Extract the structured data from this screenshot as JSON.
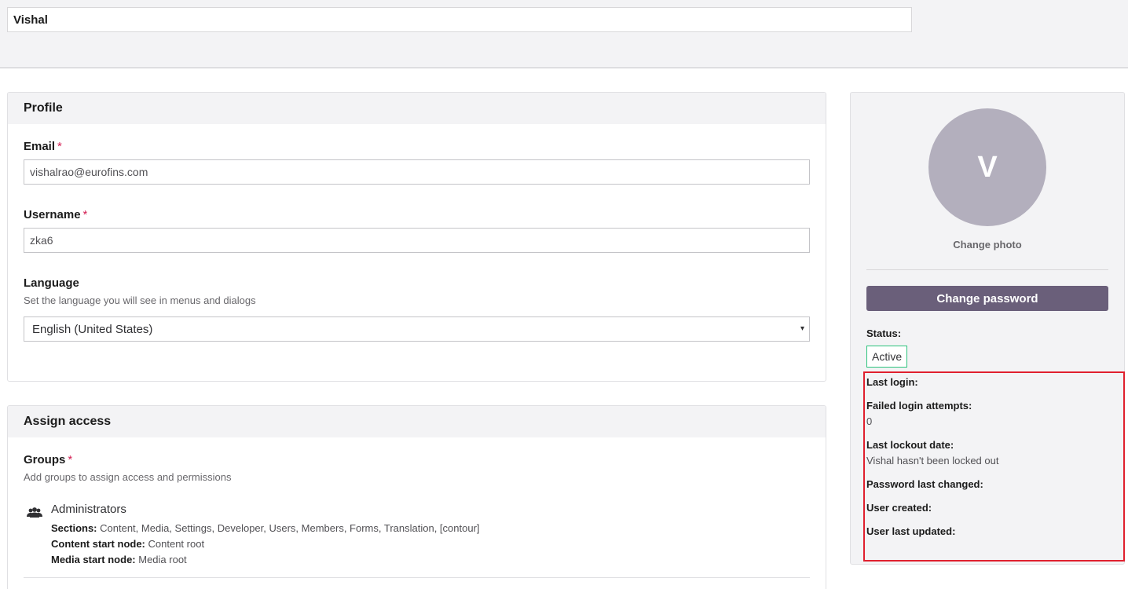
{
  "header": {
    "name_value": "Vishal"
  },
  "profile": {
    "title": "Profile",
    "email": {
      "label": "Email",
      "required": "*",
      "value": "vishalrao@eurofins.com"
    },
    "username": {
      "label": "Username",
      "required": "*",
      "value": "zka6"
    },
    "language": {
      "label": "Language",
      "description": "Set the language you will see in menus and dialogs",
      "selected": "English (United States)",
      "caret": "▾"
    }
  },
  "access": {
    "title": "Assign access",
    "groups": {
      "label": "Groups",
      "required": "*",
      "description": "Add groups to assign access and permissions",
      "items": [
        {
          "icon": "users-icon",
          "name": "Administrators",
          "sections_label": "Sections:",
          "sections_value": "Content, Media, Settings, Developer, Users, Members, Forms, Translation, [contour]",
          "content_label": "Content start node:",
          "content_value": "Content root",
          "media_label": "Media start node:",
          "media_value": "Media root"
        }
      ]
    }
  },
  "sidebar": {
    "avatar_initial": "V",
    "change_photo": "Change photo",
    "change_password": "Change password",
    "status_label": "Status:",
    "status_value": "Active",
    "last_login_label": "Last login:",
    "failed_label": "Failed login attempts:",
    "failed_value": "0",
    "lockout_label": "Last lockout date:",
    "lockout_value": "Vishal hasn't been locked out",
    "pw_changed_label": "Password last changed:",
    "created_label": "User created:",
    "updated_label": "User last updated:"
  },
  "colors": {
    "accent": "#6a5f7a",
    "status_active": "#2bc37c",
    "highlight": "#e0202e",
    "required": "#d42054"
  }
}
